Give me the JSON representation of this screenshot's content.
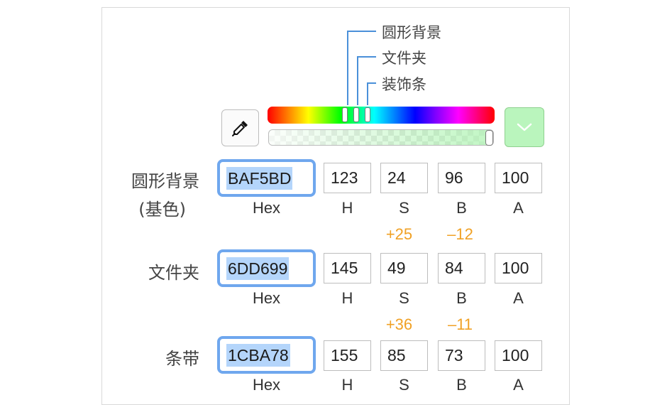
{
  "colors": {
    "accent_blue": "#6fa7ee",
    "selection": "#b4d5fb",
    "delta_orange": "#f0a125",
    "swatch": "#BAF5BD"
  },
  "callouts": [
    "圆形背景",
    "文件夹",
    "装饰条"
  ],
  "icons": {
    "eyedropper": "eyedropper-icon",
    "dropdown": "chevron-down-icon"
  },
  "channels": {
    "hex": "Hex",
    "h": "H",
    "s": "S",
    "b": "B",
    "a": "A"
  },
  "rows": [
    {
      "label_line1": "圆形背景",
      "label_line2": "(基色)",
      "hex": "BAF5BD",
      "h": "123",
      "s": "24",
      "b": "96",
      "a": "100"
    },
    {
      "label_line1": "文件夹",
      "hex": "6DD699",
      "h": "145",
      "s": "49",
      "b": "84",
      "a": "100",
      "delta_s": "+25",
      "delta_b": "–12"
    },
    {
      "label_line1": "条带",
      "hex": "1CBA78",
      "h": "155",
      "s": "85",
      "b": "73",
      "a": "100",
      "delta_s": "+36",
      "delta_b": "–11"
    }
  ]
}
